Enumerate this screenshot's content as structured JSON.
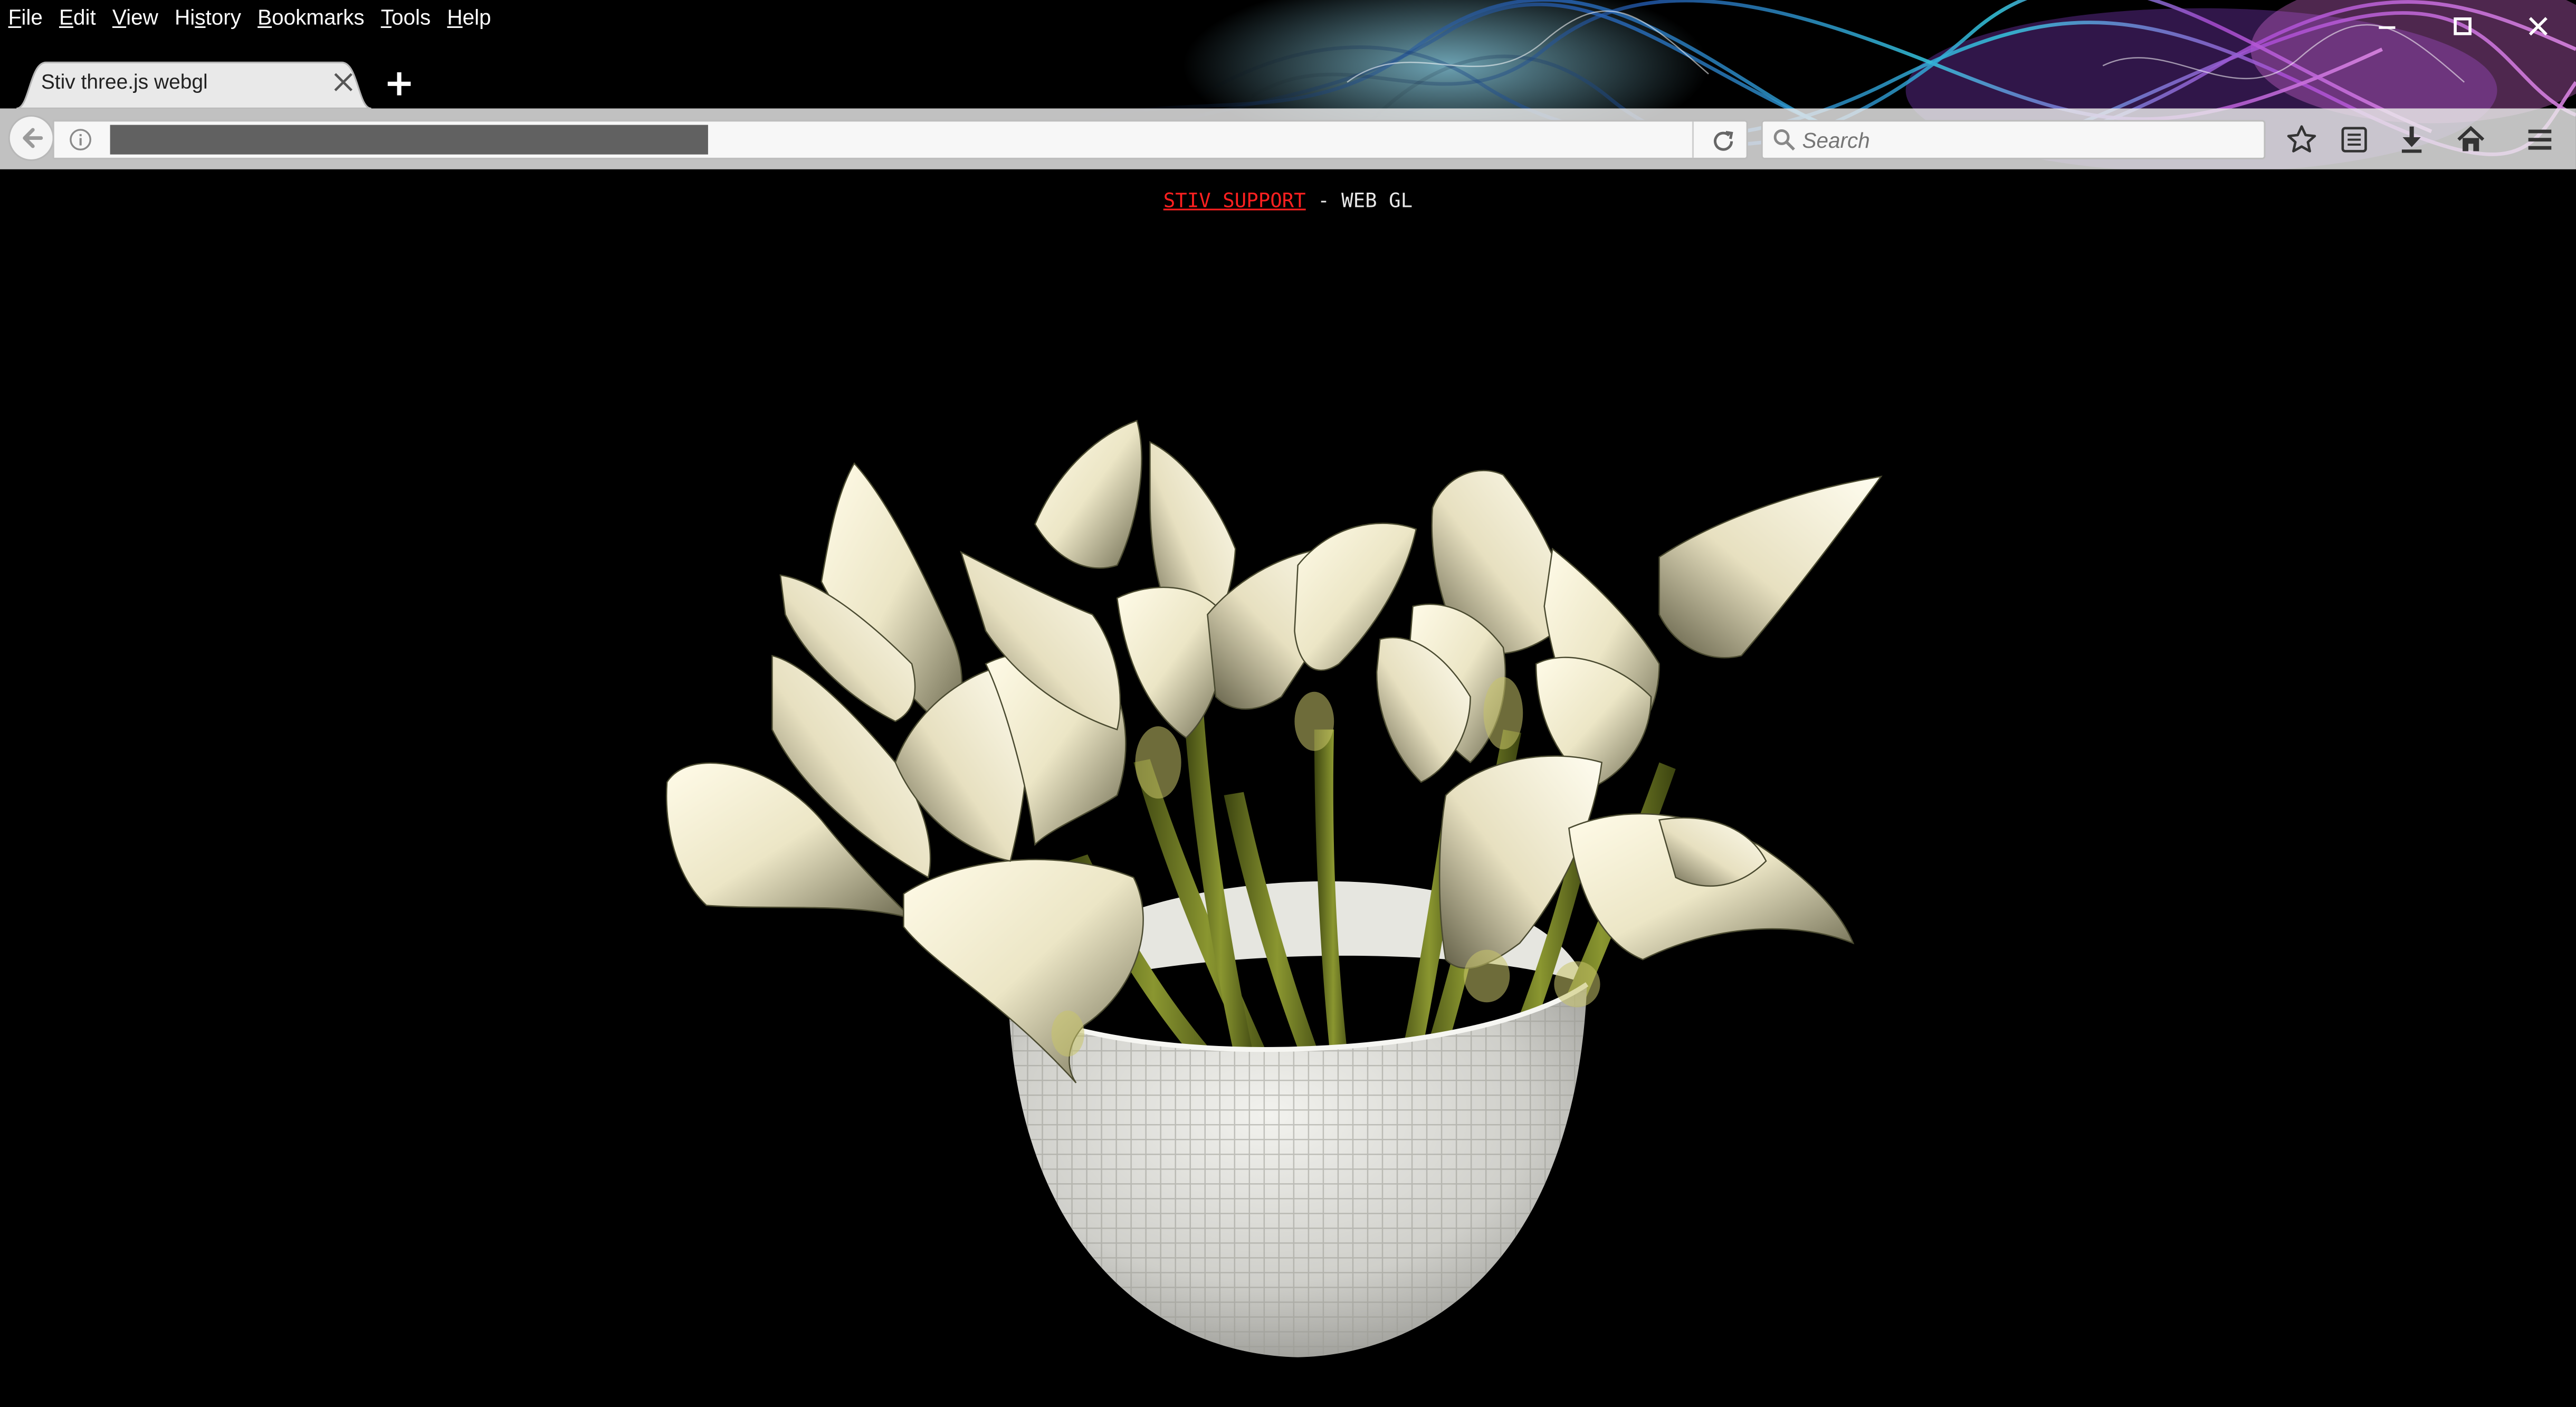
{
  "menubar": {
    "items": [
      {
        "accel": "F",
        "rest": "ile"
      },
      {
        "accel": "E",
        "rest": "dit"
      },
      {
        "accel": "V",
        "rest": "iew"
      },
      {
        "accel": "",
        "rest": "Hi",
        "accel2": "s",
        "rest2": "tory"
      },
      {
        "accel": "B",
        "rest": "ookmarks"
      },
      {
        "accel": "T",
        "rest": "ools"
      },
      {
        "accel": "H",
        "rest": "elp"
      }
    ]
  },
  "tab": {
    "title": "Stiv three.js webgl"
  },
  "search": {
    "placeholder": "Search"
  },
  "page": {
    "link_text": "STIV SUPPORT",
    "separator_text": " - WEB GL"
  },
  "colors": {
    "link": "#ff2020",
    "page_background": "#000000",
    "lily_petal": "#f3efd6",
    "stem": "#6f7a1e",
    "bowl": "#d8d8d4"
  },
  "icons": [
    "minimize-icon",
    "maximize-icon",
    "close-icon",
    "tab-close-icon",
    "new-tab-icon",
    "back-arrow-icon",
    "info-icon",
    "reload-icon",
    "search-icon",
    "bookmark-star-icon",
    "reading-list-icon",
    "download-icon",
    "home-icon",
    "menu-icon"
  ]
}
